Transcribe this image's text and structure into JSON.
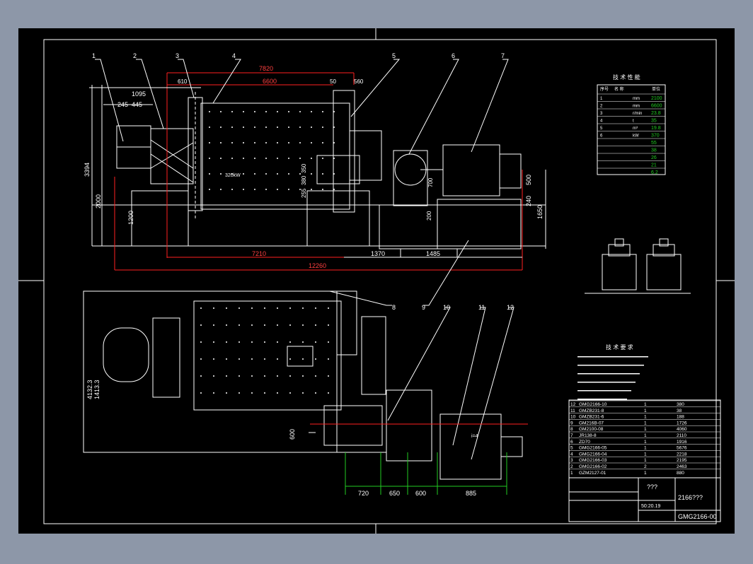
{
  "drawing": {
    "title_block": {
      "name": "???",
      "code": "2166???",
      "drawing_no": "GMG2166-00",
      "scale": "50:20.19"
    },
    "tech_table": {
      "title": "技 术 性 能",
      "headers": [
        "序号",
        "名 称",
        "单位"
      ],
      "rows": [
        {
          "no": "1",
          "unit": "mm",
          "value": "2100"
        },
        {
          "no": "2",
          "unit": "mm",
          "value": "6600"
        },
        {
          "no": "3",
          "unit": "r/min",
          "value": "23.8"
        },
        {
          "no": "4",
          "unit": "t",
          "value": "35"
        },
        {
          "no": "5",
          "unit": "m³",
          "value": "19.8"
        },
        {
          "no": "6",
          "unit": "kW",
          "value": "370"
        },
        {
          "no": "",
          "unit": "",
          "value": "55"
        },
        {
          "no": "",
          "unit": "",
          "value": "38"
        },
        {
          "no": "",
          "unit": "",
          "value": "26"
        },
        {
          "no": "",
          "unit": "",
          "value": "21"
        },
        {
          "no": "",
          "unit": "",
          "value": "6.2"
        }
      ]
    },
    "part_labels": [
      "1",
      "2",
      "3",
      "4",
      "5",
      "6",
      "7",
      "8",
      "9",
      "10",
      "11",
      "12"
    ],
    "dimensions": {
      "top": [
        "7820",
        "610",
        "6600",
        "50",
        "560",
        "1095",
        "245",
        "445"
      ],
      "left": [
        "3394",
        "2000",
        "1200"
      ],
      "middle": [
        "255",
        "380",
        "350",
        "700",
        "200"
      ],
      "right": [
        "500",
        "240",
        "1650"
      ],
      "bottom": [
        "7210",
        "1370",
        "1485",
        "12260"
      ],
      "plan_left": [
        "4132.3",
        "1413.3",
        "600"
      ],
      "plan_bottom": [
        "720",
        "650",
        "600",
        "885"
      ]
    },
    "notes_title": "技 术 要 求",
    "parts_list": [
      {
        "no": "12",
        "code": "GMG2166-10",
        "qty": "1",
        "mass": "380"
      },
      {
        "no": "11",
        "code": "GMZB231-8",
        "qty": "1",
        "mass": "38"
      },
      {
        "no": "10",
        "code": "GMZB231-6",
        "qty": "1",
        "mass": "188"
      },
      {
        "no": "9",
        "code": "GM216B-07",
        "qty": "1",
        "mass": "1726"
      },
      {
        "no": "8",
        "code": "GM2100-08",
        "qty": "1",
        "mass": "4060"
      },
      {
        "no": "7",
        "code": "JR138-8",
        "qty": "1",
        "mass": "2110"
      },
      {
        "no": "6",
        "code": "ZD70",
        "qty": "1",
        "mass": "1916"
      },
      {
        "no": "5",
        "code": "GMG2166-05",
        "qty": "1",
        "mass": "5676"
      },
      {
        "no": "4",
        "code": "GMG2166-04",
        "qty": "1",
        "mass": "2218"
      },
      {
        "no": "3",
        "code": "GMG2166-03",
        "qty": "1",
        "mass": "2195"
      },
      {
        "no": "2",
        "code": "GMG2166-02",
        "qty": "2",
        "mass": "2463"
      },
      {
        "no": "1",
        "code": "GZM2127-01",
        "qty": "1",
        "mass": "880"
      }
    ],
    "motor_spec": "320kW",
    "ratio": "i=4"
  },
  "colors": {
    "line": "#ffffff",
    "dim": "#ff2020",
    "green": "#22cc22",
    "cyan": "#00c8ff",
    "bg": "#000000",
    "frame": "#8d97a8"
  }
}
